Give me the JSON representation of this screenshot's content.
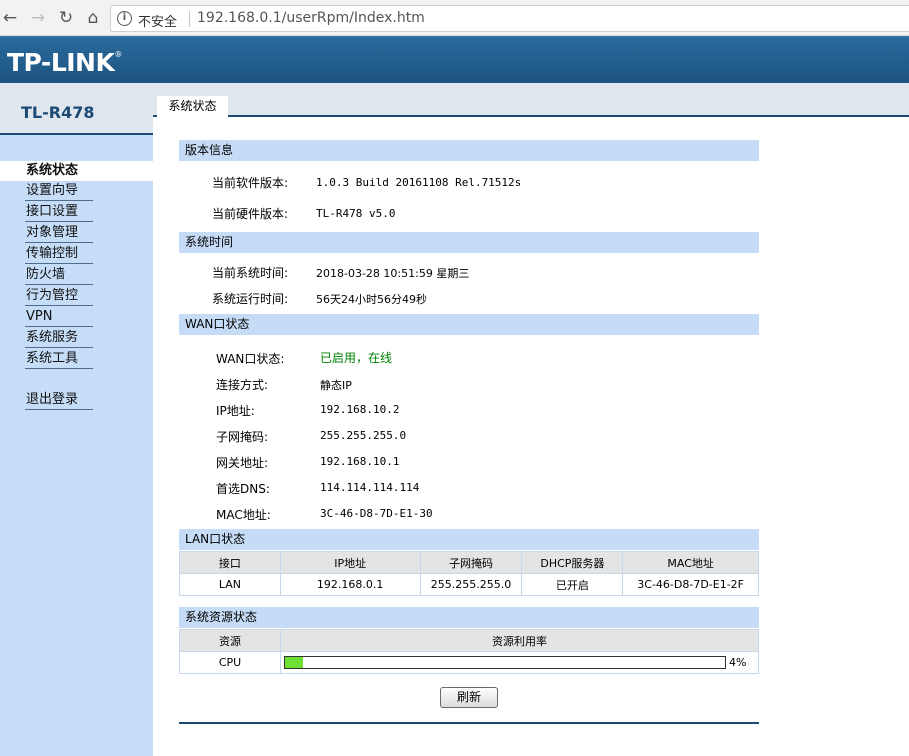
{
  "browser": {
    "security_label": "不安全",
    "url": "192.168.0.1/userRpm/Index.htm"
  },
  "banner": {
    "logo": "TP-LINK",
    "logo_mark": "®"
  },
  "model": "TL-R478",
  "tab": "系统状态",
  "sidebar": {
    "items": [
      {
        "label": "系统状态"
      },
      {
        "label": "设置向导"
      },
      {
        "label": "接口设置"
      },
      {
        "label": "对象管理"
      },
      {
        "label": "传输控制"
      },
      {
        "label": "防火墙"
      },
      {
        "label": "行为管控"
      },
      {
        "label": "VPN"
      },
      {
        "label": "系统服务"
      },
      {
        "label": "系统工具"
      },
      {
        "label": "退出登录"
      }
    ]
  },
  "version": {
    "title": "版本信息",
    "sw_label": "当前软件版本:",
    "sw_value": "1.0.3 Build 20161108 Rel.71512s",
    "hw_label": "当前硬件版本:",
    "hw_value": "TL-R478 v5.0"
  },
  "time": {
    "title": "系统时间",
    "now_label": "当前系统时间:",
    "now_value": "2018-03-28 10:51:59 星期三",
    "uptime_label": "系统运行时间:",
    "uptime_value": "56天24小时56分49秒"
  },
  "wan": {
    "title": "WAN口状态",
    "rows": [
      {
        "label": "WAN口状态:",
        "value": "已启用，在线"
      },
      {
        "label": "连接方式:",
        "value": "静态IP"
      },
      {
        "label": "IP地址:",
        "value": "192.168.10.2"
      },
      {
        "label": "子网掩码:",
        "value": "255.255.255.0"
      },
      {
        "label": "网关地址:",
        "value": "192.168.10.1"
      },
      {
        "label": "首选DNS:",
        "value": "114.114.114.114"
      },
      {
        "label": "MAC地址:",
        "value": "3C-46-D8-7D-E1-30"
      }
    ]
  },
  "lan": {
    "title": "LAN口状态",
    "headers": [
      "接口",
      "IP地址",
      "子网掩码",
      "DHCP服务器",
      "MAC地址"
    ],
    "row": [
      "LAN",
      "192.168.0.1",
      "255.255.255.0",
      "已开启",
      "3C-46-D8-7D-E1-2F"
    ]
  },
  "resources": {
    "title": "系统资源状态",
    "headers": [
      "资源",
      "资源利用率"
    ],
    "cpu_label": "CPU",
    "cpu_percent": 4,
    "cpu_text": "4%"
  },
  "refresh_label": "刷新"
}
